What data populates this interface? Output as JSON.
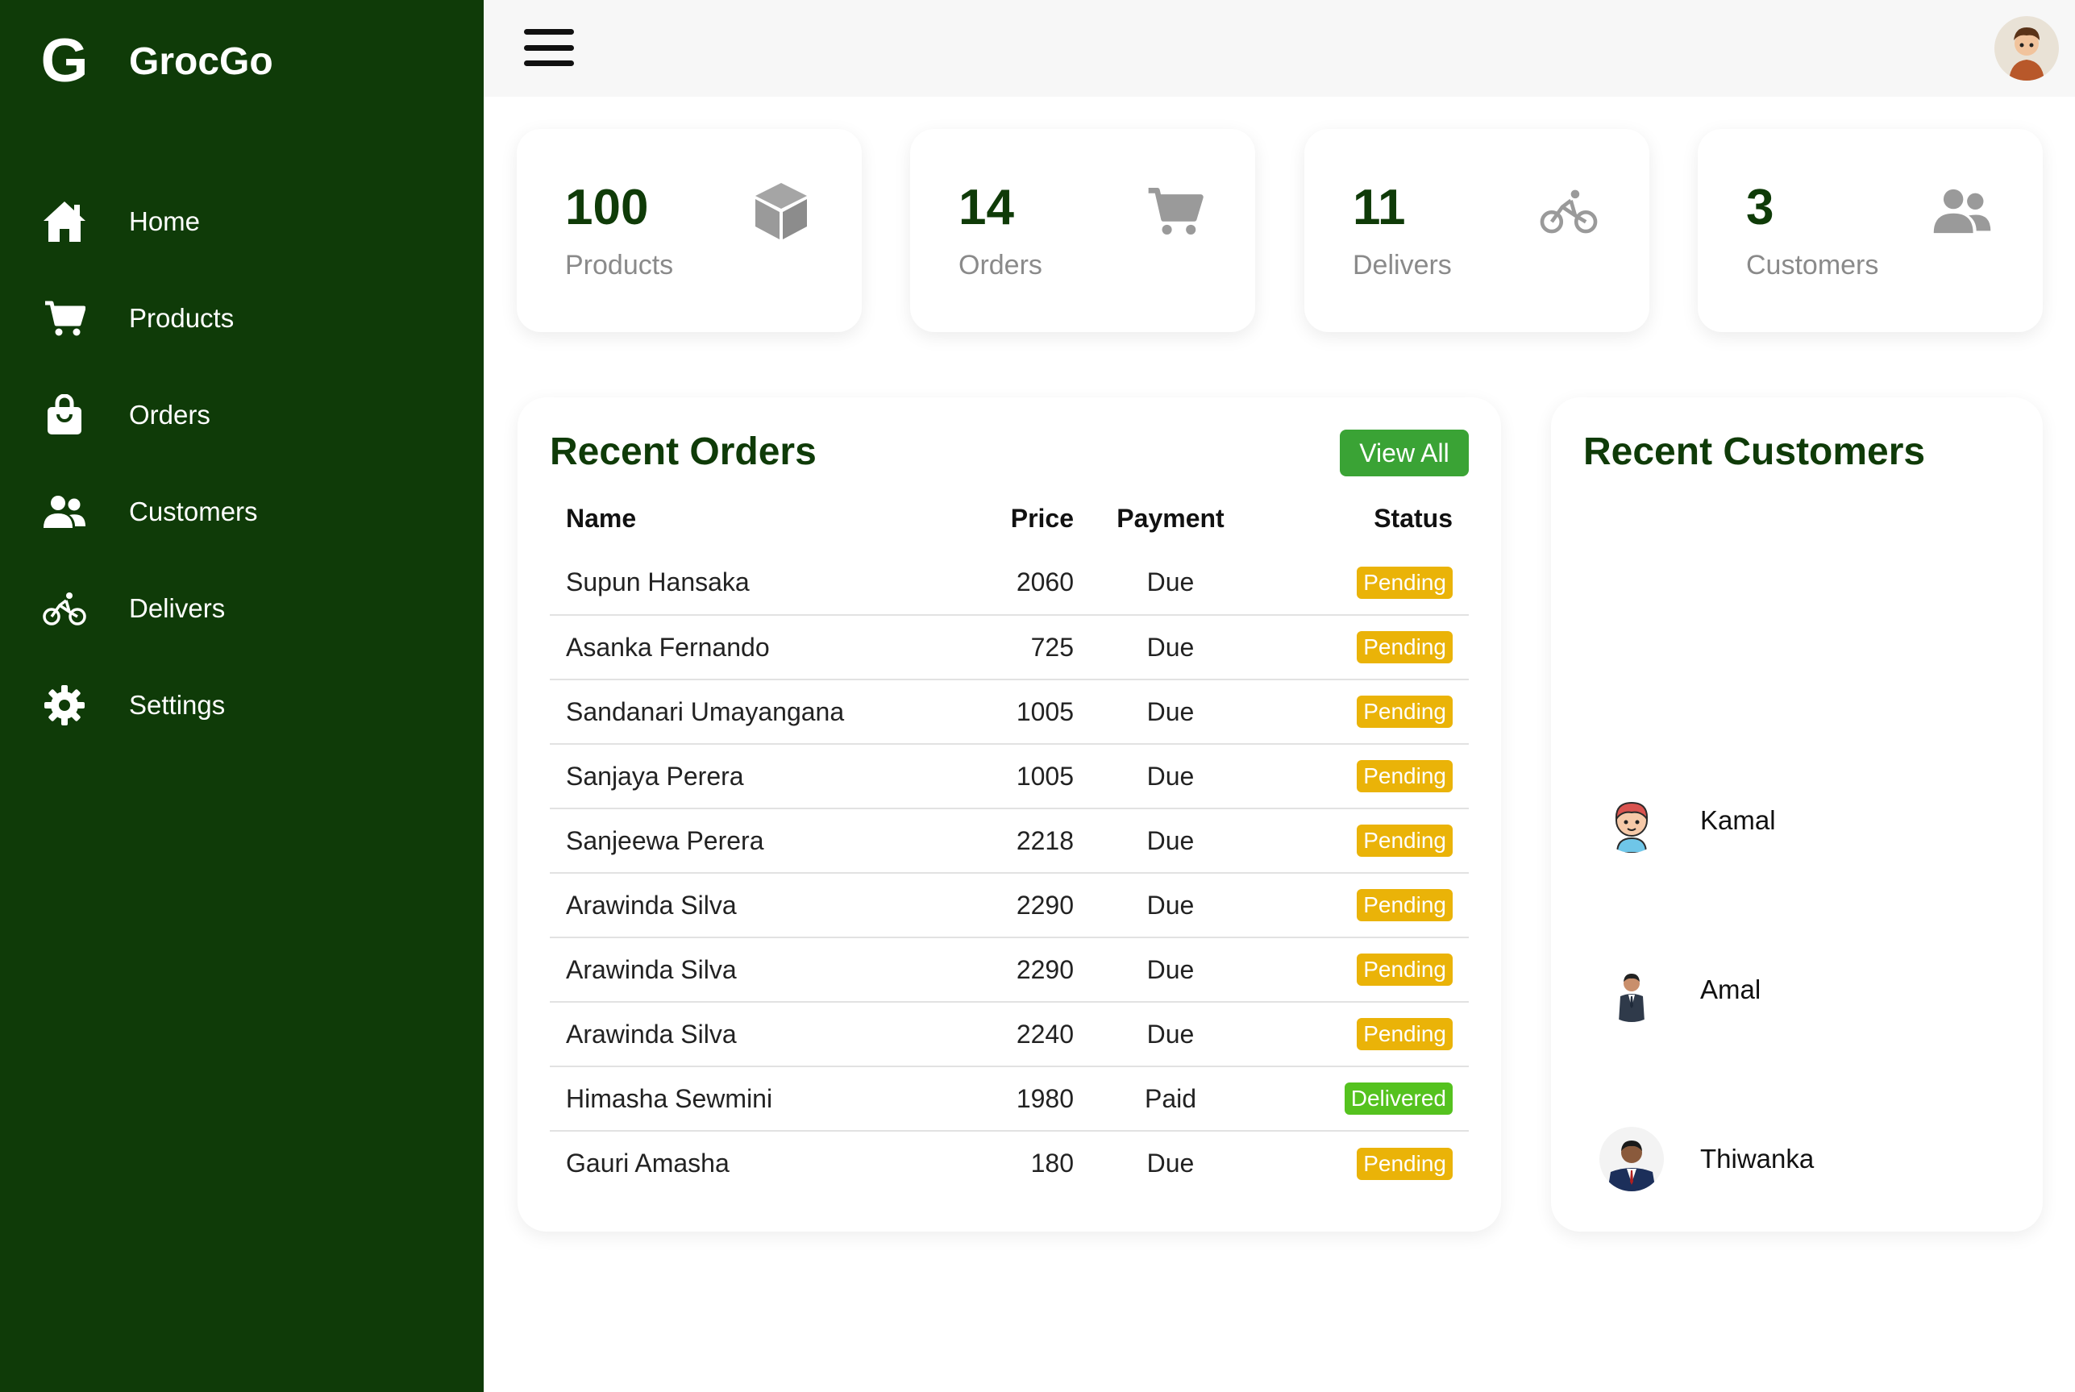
{
  "brand": {
    "logo_letter": "G",
    "name": "GrocGo"
  },
  "colors": {
    "sidebar": "#0f3b08",
    "accent": "#3aa335",
    "pending": "#eab308",
    "delivered": "#55c21f"
  },
  "sidebar": {
    "items": [
      {
        "label": "Home",
        "icon": "home-icon"
      },
      {
        "label": "Products",
        "icon": "cart-icon"
      },
      {
        "label": "Orders",
        "icon": "shopping-bag-icon"
      },
      {
        "label": "Customers",
        "icon": "users-icon"
      },
      {
        "label": "Delivers",
        "icon": "bicycle-icon"
      },
      {
        "label": "Settings",
        "icon": "gear-icon"
      }
    ]
  },
  "topbar": {
    "menu_icon": "hamburger-icon",
    "avatar": "user-avatar"
  },
  "stats": [
    {
      "value": "100",
      "label": "Products",
      "icon": "box-icon"
    },
    {
      "value": "14",
      "label": "Orders",
      "icon": "cart-icon"
    },
    {
      "value": "11",
      "label": "Delivers",
      "icon": "bicycle-icon"
    },
    {
      "value": "3",
      "label": "Customers",
      "icon": "users-icon"
    }
  ],
  "recent_orders": {
    "title": "Recent Orders",
    "view_all": "View All",
    "headers": {
      "name": "Name",
      "price": "Price",
      "payment": "Payment",
      "status": "Status"
    },
    "rows": [
      {
        "name": "Supun Hansaka",
        "price": "2060",
        "payment": "Due",
        "status": "Pending"
      },
      {
        "name": "Asanka Fernando",
        "price": "725",
        "payment": "Due",
        "status": "Pending"
      },
      {
        "name": "Sandanari Umayangana",
        "price": "1005",
        "payment": "Due",
        "status": "Pending"
      },
      {
        "name": "Sanjaya Perera",
        "price": "1005",
        "payment": "Due",
        "status": "Pending"
      },
      {
        "name": "Sanjeewa Perera",
        "price": "2218",
        "payment": "Due",
        "status": "Pending"
      },
      {
        "name": "Arawinda Silva",
        "price": "2290",
        "payment": "Due",
        "status": "Pending"
      },
      {
        "name": "Arawinda Silva",
        "price": "2290",
        "payment": "Due",
        "status": "Pending"
      },
      {
        "name": "Arawinda Silva",
        "price": "2240",
        "payment": "Due",
        "status": "Pending"
      },
      {
        "name": "Himasha Sewmini",
        "price": "1980",
        "payment": "Paid",
        "status": "Delivered"
      },
      {
        "name": "Gauri Amasha",
        "price": "180",
        "payment": "Due",
        "status": "Pending"
      }
    ]
  },
  "recent_customers": {
    "title": "Recent Customers",
    "items": [
      {
        "name": "Kamal"
      },
      {
        "name": "Amal"
      },
      {
        "name": "Thiwanka"
      }
    ]
  }
}
